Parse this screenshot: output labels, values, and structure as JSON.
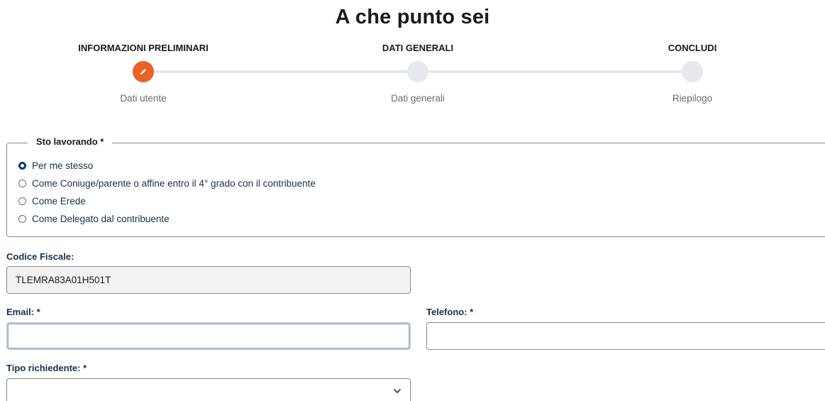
{
  "page": {
    "title": "A che punto sei"
  },
  "stepper": {
    "steps": [
      {
        "heading": "INFORMAZIONI PRELIMINARI",
        "sublabel": "Dati utente",
        "state": "active",
        "icon": "pencil-icon"
      },
      {
        "heading": "DATI GENERALI",
        "sublabel": "Dati generali",
        "state": "pending",
        "icon": ""
      },
      {
        "heading": "CONCLUDI",
        "sublabel": "Riepilogo",
        "state": "pending",
        "icon": ""
      }
    ],
    "active_color": "#e8622a",
    "pending_color": "#e6e9ed"
  },
  "working_for": {
    "legend": "Sto lavorando *",
    "options": [
      {
        "label": "Per me stesso",
        "checked": true
      },
      {
        "label": "Come Coniuge/parente o affine entro il 4° grado con il contribuente",
        "checked": false
      },
      {
        "label": "Come Erede",
        "checked": false
      },
      {
        "label": "Come Delegato dal contribuente",
        "checked": false
      }
    ]
  },
  "form": {
    "codice_fiscale": {
      "label": "Codice Fiscale:",
      "value": "TLEMRA83A01H501T"
    },
    "email": {
      "label": "Email: *",
      "value": ""
    },
    "telefono": {
      "label": "Telefono: *",
      "value": ""
    },
    "tipo_richiedente": {
      "label": "Tipo richiedente: *",
      "selected": ""
    }
  },
  "colors": {
    "label_text": "#17324d",
    "radio_checked": "#0b3d6b"
  }
}
